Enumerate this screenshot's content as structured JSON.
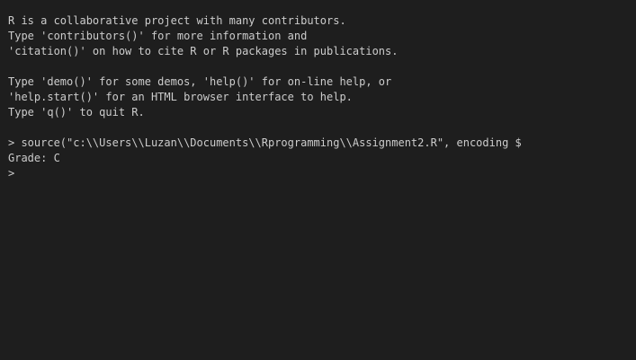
{
  "terminal": {
    "lines": [
      "R is a collaborative project with many contributors.",
      "Type 'contributors()' for more information and",
      "'citation()' on how to cite R or R packages in publications.",
      "",
      "Type 'demo()' for some demos, 'help()' for on-line help, or",
      "'help.start()' for an HTML browser interface to help.",
      "Type 'q()' to quit R.",
      "",
      "> source(\"c:\\\\Users\\\\Luzan\\\\Documents\\\\Rprogramming\\\\Assignment2.R\", encoding $",
      "Grade: C",
      ">"
    ]
  }
}
